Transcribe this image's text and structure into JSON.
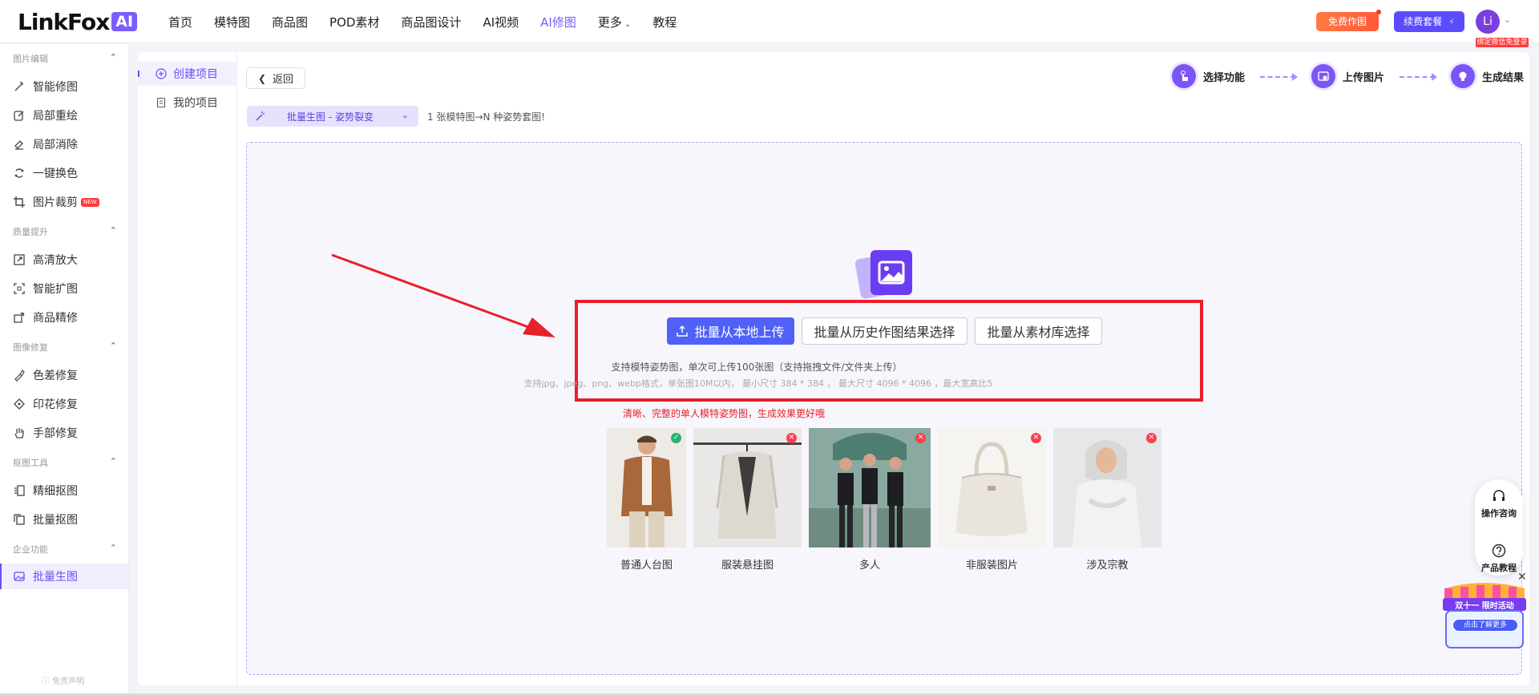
{
  "brand": {
    "name": "LinkFox",
    "badge": "AI",
    "accent": "#7b5cff"
  },
  "nav": {
    "items": [
      {
        "label": "首页"
      },
      {
        "label": "模特图"
      },
      {
        "label": "商品图"
      },
      {
        "label": "POD素材"
      },
      {
        "label": "商品图设计"
      },
      {
        "label": "AI视频"
      },
      {
        "label": "AI修图",
        "active": true
      },
      {
        "label": "更多"
      },
      {
        "label": "教程"
      }
    ]
  },
  "header": {
    "free_button": "免费作图",
    "renew_button": "续费套餐",
    "renew_icon": "lightning-icon",
    "avatar": "Li",
    "avatar_badge": "绑定微信免登录"
  },
  "sidebar": {
    "groups": [
      {
        "title": "图片编辑",
        "items": [
          {
            "label": "智能修图",
            "icon": "magic-wand-icon"
          },
          {
            "label": "局部重绘",
            "icon": "edit-icon"
          },
          {
            "label": "局部消除",
            "icon": "eraser-icon"
          },
          {
            "label": "一键换色",
            "icon": "color-swap-icon"
          },
          {
            "label": "图片裁剪",
            "icon": "crop-icon",
            "badge": "NEW"
          }
        ]
      },
      {
        "title": "质量提升",
        "items": [
          {
            "label": "高清放大",
            "icon": "upscale-icon"
          },
          {
            "label": "智能扩图",
            "icon": "expand-icon"
          },
          {
            "label": "商品精修",
            "icon": "retouch-icon"
          }
        ]
      },
      {
        "title": "图像修复",
        "items": [
          {
            "label": "色差修复",
            "icon": "color-fix-icon"
          },
          {
            "label": "印花修复",
            "icon": "print-fix-icon"
          },
          {
            "label": "手部修复",
            "icon": "hand-icon"
          }
        ]
      },
      {
        "title": "抠图工具",
        "items": [
          {
            "label": "精细抠图",
            "icon": "cutout-icon"
          },
          {
            "label": "批量抠图",
            "icon": "batch-cutout-icon"
          }
        ]
      },
      {
        "title": "企业功能",
        "items": [
          {
            "label": "批量生图",
            "icon": "image-icon",
            "active": true
          }
        ]
      }
    ],
    "disclaimer": "免责声明"
  },
  "projects": {
    "items": [
      {
        "label": "创建项目",
        "icon": "plus-circle-icon",
        "active": true
      },
      {
        "label": "我的项目",
        "icon": "document-icon"
      }
    ]
  },
  "main": {
    "back_label": "返回",
    "steps": [
      {
        "label": "选择功能",
        "icon": "pointer-icon"
      },
      {
        "label": "上传图片",
        "icon": "upload-image-icon"
      },
      {
        "label": "生成结果",
        "icon": "bulb-icon"
      }
    ],
    "mode_select": {
      "value": "批量生图 - 姿势裂变"
    },
    "mode_tip": "1 张模特图→N 种姿势套图!",
    "upload": {
      "primary_button": "批量从本地上传",
      "history_button": "批量从历史作图结果选择",
      "library_button": "批量从素材库选择",
      "desc": "支持模特姿势图，单次可上传100张图（支持拖拽文件/文件夹上传）",
      "formats": "支持jpg、jpeg、png、webp格式，单张图10M以内， 最小尺寸 384 * 384 ， 最大尺寸 4096 * 4096 ，最大宽高比5",
      "hint": "清晰、完整的单人模特姿势图，生成效果更好哦"
    },
    "samples": [
      {
        "caption": "普通人台图",
        "status": "ok"
      },
      {
        "caption": "服装悬挂图",
        "status": "no"
      },
      {
        "caption": "多人",
        "status": "no"
      },
      {
        "caption": "非服装图片",
        "status": "no"
      },
      {
        "caption": "涉及宗教",
        "status": "no"
      }
    ]
  },
  "float_panel": {
    "consult": "操作咨询",
    "tutorial": "产品教程"
  },
  "promo": {
    "title": "双十一 限时活动",
    "button": "点击了解更多"
  }
}
